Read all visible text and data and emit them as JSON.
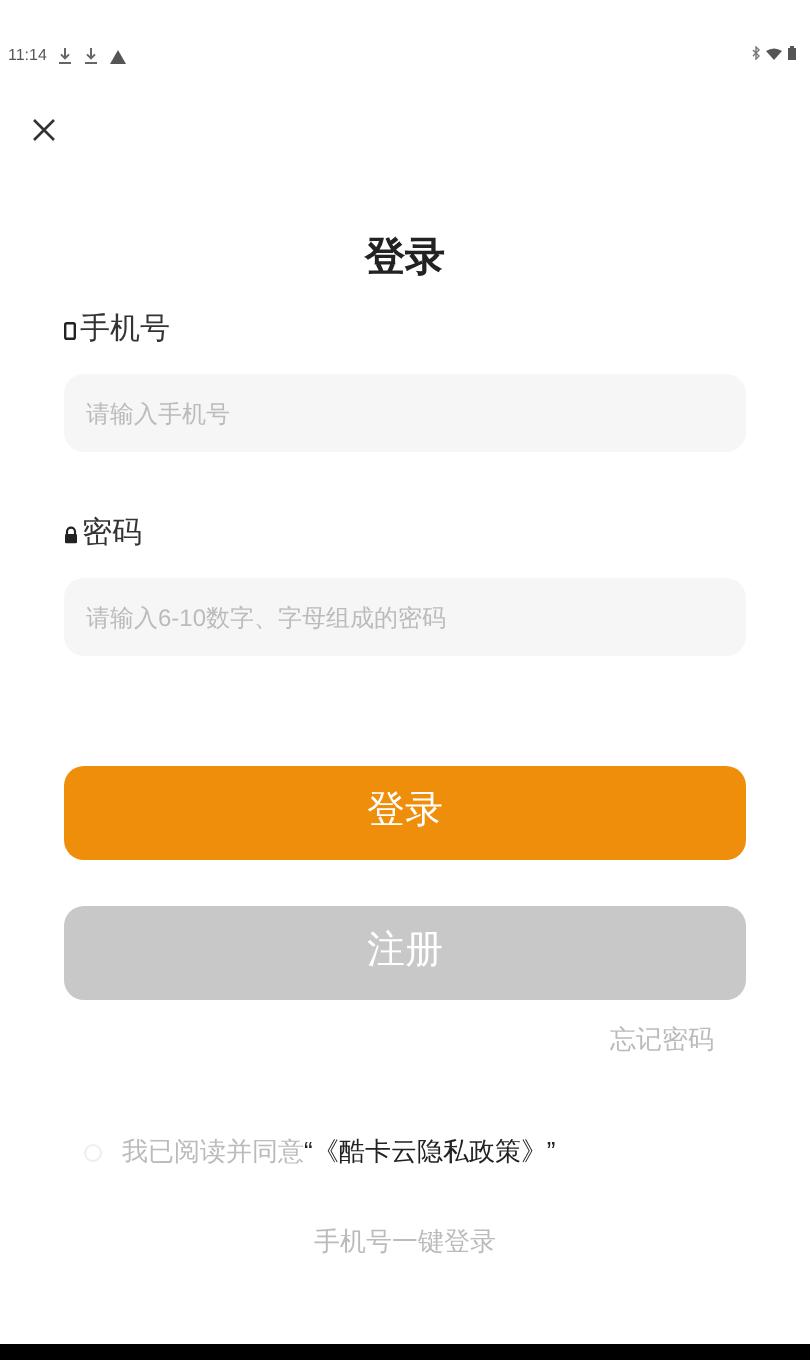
{
  "status_bar": {
    "time": "11:14"
  },
  "title": "登录",
  "fields": [
    {
      "kind": "phone",
      "label": "手机号",
      "placeholder": "请输入手机号"
    },
    {
      "kind": "password",
      "label": "密码",
      "placeholder": "请输入6-10数字、字母组成的密码"
    }
  ],
  "login_button": "登录",
  "register_button": "注册",
  "forgot_link": "忘记密码",
  "agreement": {
    "checked": false,
    "text": "我已阅读并同意",
    "link": "“《酷卡云隐私政策》”"
  },
  "one_key_login": "手机号一键登录"
}
